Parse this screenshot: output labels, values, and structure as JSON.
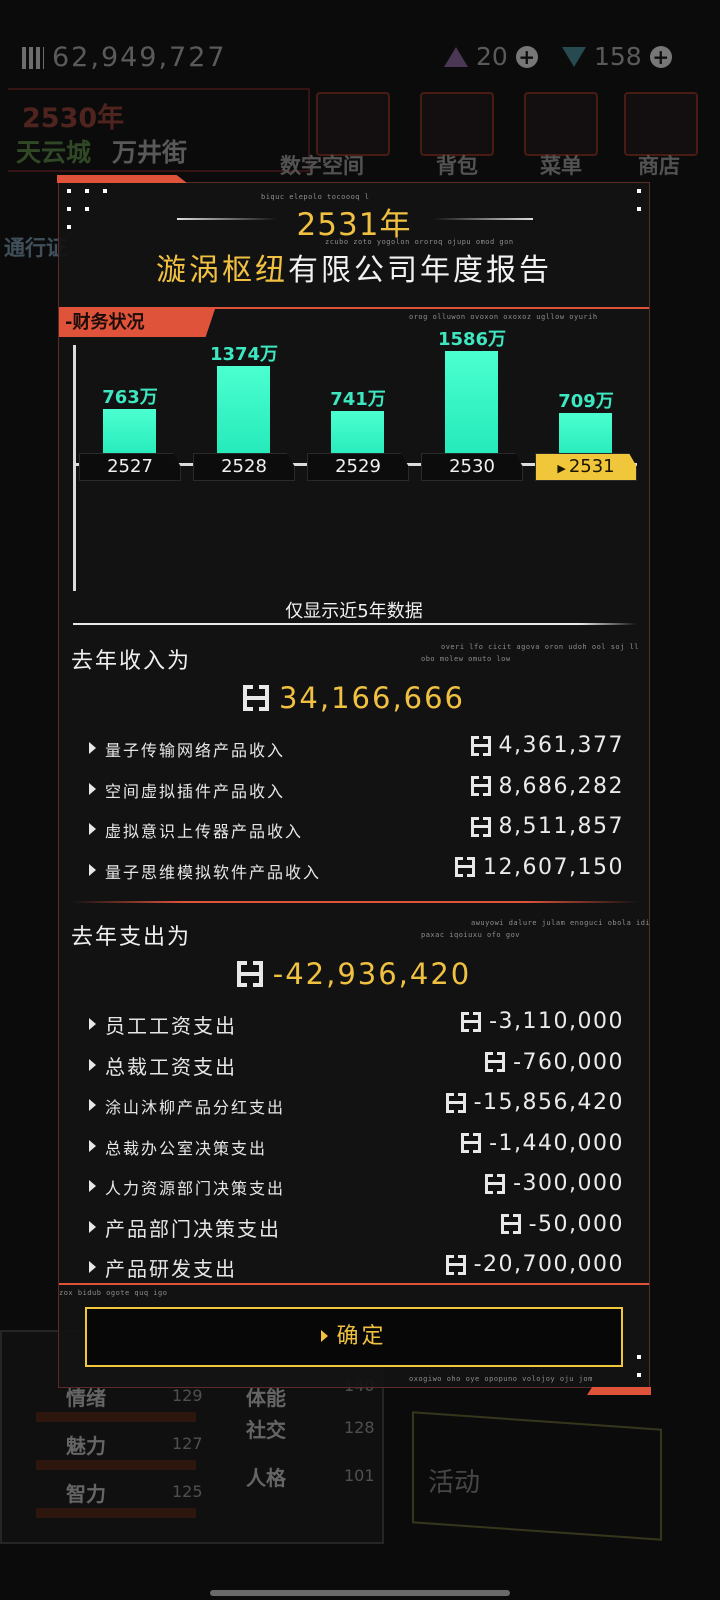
{
  "hud": {
    "money": "62,949,727",
    "res1": "20",
    "res2": "158",
    "year": "2530年",
    "city": "天云城",
    "street": "万井街",
    "menu": [
      {
        "label": "数字空间",
        "icon": "layers-icon"
      },
      {
        "label": "背包",
        "icon": "bag-icon"
      },
      {
        "label": "菜单",
        "icon": "menu-icon"
      },
      {
        "label": "商店",
        "icon": "cart-icon"
      }
    ],
    "pass_label": "通行证",
    "stats": [
      {
        "label": "情绪",
        "value": "129"
      },
      {
        "label": "魅力",
        "value": "127"
      },
      {
        "label": "智力",
        "value": "125"
      },
      {
        "label": "体能",
        "value": "140"
      },
      {
        "label": "社交",
        "value": "128"
      },
      {
        "label": "人格",
        "value": "101"
      }
    ],
    "activity_label": "活动"
  },
  "report": {
    "year": "2531年",
    "title_highlight": "漩涡枢纽",
    "title_rest": "有限公司年度报告",
    "section_finance": "-财务状况",
    "chart_note": "仅显示近5年数据",
    "income_title": "去年收入为",
    "income_total": "34,166,666",
    "income_rows": [
      {
        "label": "量子传输网络产品收入",
        "value": "4,361,377"
      },
      {
        "label": "空间虚拟插件产品收入",
        "value": "8,686,282"
      },
      {
        "label": "虚拟意识上传器产品收入",
        "value": "8,511,857"
      },
      {
        "label": "量子思维模拟软件产品收入",
        "value": "12,607,150"
      }
    ],
    "expense_title": "去年支出为",
    "expense_total": "-42,936,420",
    "expense_rows": [
      {
        "label": "员工工资支出",
        "value": "-3,110,000",
        "big": true
      },
      {
        "label": "总裁工资支出",
        "value": "-760,000",
        "big": true
      },
      {
        "label": "涂山沐柳产品分红支出",
        "value": "-15,856,420",
        "big": false
      },
      {
        "label": "总裁办公室决策支出",
        "value": "-1,440,000",
        "big": false
      },
      {
        "label": "人力资源部门决策支出",
        "value": "-300,000",
        "big": false
      },
      {
        "label": "产品部门决策支出",
        "value": "-50,000",
        "big": true
      },
      {
        "label": "产品研发支出",
        "value": "-20,700,000",
        "big": true
      }
    ],
    "confirm_label": "确定",
    "micro_texts": [
      "biquc elepolo tocoooq l",
      "zcubo zoto yogolon ororoq ojupu omod gon",
      "orog olluwon ovoxon oxoxoz ugllow oyurih",
      "overi lfo cicit agova oron udoh ool soj ll",
      "obo molew omuto low",
      "awuyowi dalure julam enoguci obola idi",
      "paxac iqoiuxu ofo gov",
      "zox bidub ogote quq igo",
      "oxogiwo oho oye opopuno volojoy oju jom"
    ]
  },
  "chart_data": {
    "type": "bar",
    "categories": [
      "2527",
      "2528",
      "2529",
      "2530",
      "2531"
    ],
    "values": [
      763,
      1374,
      741,
      1586,
      709
    ],
    "value_labels": [
      "763万",
      "1374万",
      "741万",
      "1586万",
      "709万"
    ],
    "highlight_category": "2531",
    "title": "",
    "xlabel": "",
    "ylabel": "",
    "bar_color": "#2ef5c4",
    "highlight_color": "#f0c63a"
  },
  "colors": {
    "accent_gold": "#f0c040",
    "accent_red": "#e0533b",
    "teal": "#3de7c0"
  }
}
